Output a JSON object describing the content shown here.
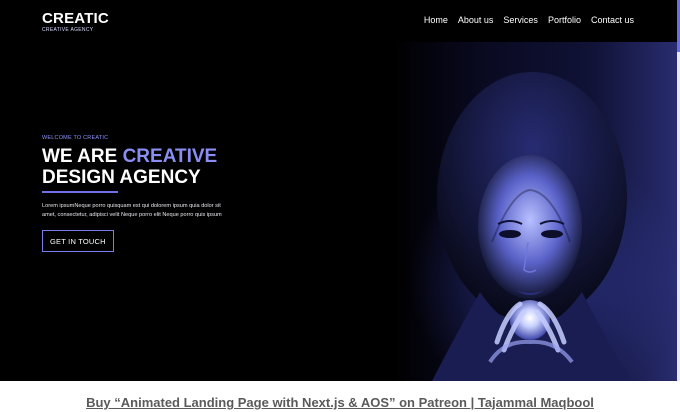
{
  "brand": {
    "name": "CREATIC",
    "tagline": "CREATIVE AGENCY"
  },
  "nav": {
    "items": [
      {
        "label": "Home"
      },
      {
        "label": "About us"
      },
      {
        "label": "Services"
      },
      {
        "label": "Portfolio"
      },
      {
        "label": "Contact us"
      }
    ]
  },
  "hero": {
    "eyebrow": "WELCOME TO CREATIC",
    "headline_prefix": "WE ARE ",
    "headline_accent": "CREATIVE",
    "headline_line2": "DESIGN AGENCY",
    "body_line1": "Lorem ipsumNeque porro quisquam est qui dolorem ipsum quia dolor sit",
    "body_line2": "amet, consectetur, adipisci velit Neque porro elit Neque porro quis ipsum",
    "cta_label": "GET IN TOUCH"
  },
  "promo": {
    "link_text": "Buy “Animated Landing Page with Next.js & AOS” on Patreon | Tajammal Maqbool"
  },
  "colors": {
    "accent": "#8a8ef2",
    "hero_bg": "#000000",
    "page_bg": "#ffffff"
  }
}
